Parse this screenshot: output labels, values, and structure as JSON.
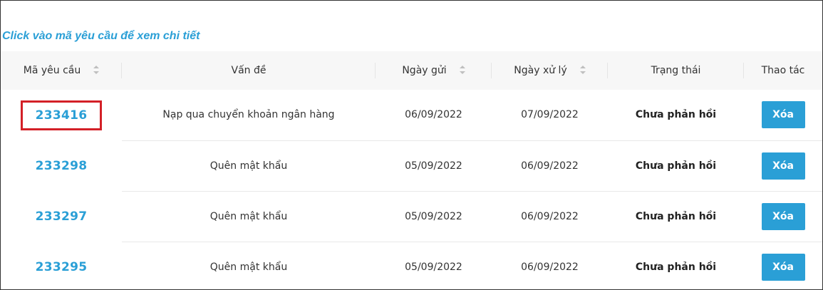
{
  "hint": "Click vào mã yêu cầu để xem chi tiết",
  "table": {
    "headers": {
      "code": "Mã yêu cầu",
      "issue": "Vấn đề",
      "sent_date": "Ngày gửi",
      "processed_date": "Ngày xử lý",
      "status": "Trạng thái",
      "actions": "Thao tác"
    },
    "rows": [
      {
        "code": "233416",
        "issue": "Nạp qua chuyển khoản ngân hàng",
        "sent": "06/09/2022",
        "processed": "07/09/2022",
        "status": "Chưa phản hồi",
        "action": "Xóa"
      },
      {
        "code": "233298",
        "issue": "Quên mật khẩu",
        "sent": "05/09/2022",
        "processed": "06/09/2022",
        "status": "Chưa phản hồi",
        "action": "Xóa"
      },
      {
        "code": "233297",
        "issue": "Quên mật khẩu",
        "sent": "05/09/2022",
        "processed": "06/09/2022",
        "status": "Chưa phản hồi",
        "action": "Xóa"
      },
      {
        "code": "233295",
        "issue": "Quên mật khẩu",
        "sent": "05/09/2022",
        "processed": "06/09/2022",
        "status": "Chưa phản hồi",
        "action": "Xóa"
      }
    ]
  },
  "colors": {
    "accent": "#2a9fd6",
    "highlight_box": "#d32027",
    "header_bg": "#f7f7f7"
  },
  "icons": {
    "sort": "sort-icon"
  }
}
